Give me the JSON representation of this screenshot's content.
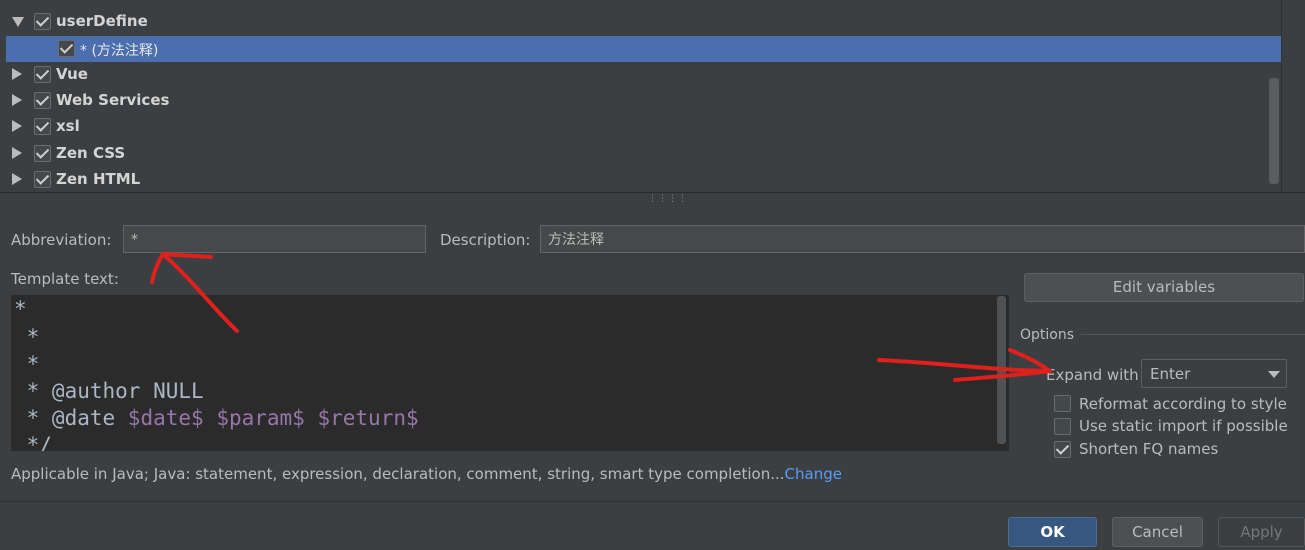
{
  "tree": {
    "items": [
      {
        "label": "userDefine",
        "expanded": true,
        "checked": true
      },
      {
        "label": "* (方法注释)",
        "checked": true,
        "selected": true
      },
      {
        "label": "Vue",
        "expanded": false,
        "checked": true
      },
      {
        "label": "Web Services",
        "expanded": false,
        "checked": true
      },
      {
        "label": "xsl",
        "expanded": false,
        "checked": true
      },
      {
        "label": "Zen CSS",
        "expanded": false,
        "checked": true
      },
      {
        "label": "Zen HTML",
        "expanded": false,
        "checked": true
      }
    ]
  },
  "form": {
    "abbreviation_label": "Abbreviation:",
    "abbreviation_value": "*",
    "description_label": "Description:",
    "description_value": "方法注释",
    "template_label": "Template text:"
  },
  "editor": {
    "line1": "*",
    "line2": " *",
    "line3": " *",
    "line4": " * @author NULL",
    "line5_prefix": " * @date ",
    "var_date": "$date$",
    "var_param": "$param$",
    "var_return": "$return$",
    "line6": " */"
  },
  "applicable": {
    "text": "Applicable in Java; Java: statement, expression, declaration, comment, string, smart type completion...",
    "link": "Change"
  },
  "options": {
    "edit_variables": "Edit variables",
    "title": "Options",
    "expand_with_label": "Expand with",
    "expand_with_value": "Enter",
    "reformat_label": "Reformat according to style",
    "reformat_checked": false,
    "static_import_label": "Use static import if possible",
    "static_import_checked": false,
    "shorten_label": "Shorten FQ names",
    "shorten_checked": true
  },
  "buttons": {
    "ok": "OK",
    "cancel": "Cancel",
    "apply": "Apply"
  },
  "colors": {
    "background": "#3c3f41",
    "selection": "#4b6eaf",
    "editor_bg": "#2b2b2b",
    "template_variable": "#9876aa",
    "link": "#589df6",
    "annotation_red": "#e0201c"
  }
}
